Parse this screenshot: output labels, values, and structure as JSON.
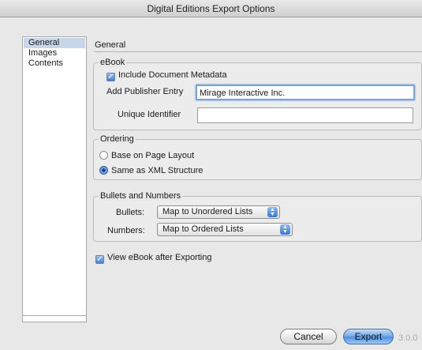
{
  "window": {
    "title": "Digital Editions Export Options"
  },
  "sidebar": {
    "items": [
      {
        "label": "General"
      },
      {
        "label": "Images"
      },
      {
        "label": "Contents"
      }
    ]
  },
  "main": {
    "heading": "General",
    "ebook": {
      "legend": "eBook",
      "include_metadata": {
        "label": "Include Document Metadata",
        "checked": true
      },
      "publisher": {
        "label": "Add Publisher Entry",
        "value": "Mirage Interactive Inc."
      },
      "identifier": {
        "label": "Unique Identifier",
        "value": ""
      }
    },
    "ordering": {
      "legend": "Ordering",
      "options": [
        {
          "label": "Base on Page Layout",
          "selected": false
        },
        {
          "label": "Same as XML Structure",
          "selected": true
        }
      ]
    },
    "bullets": {
      "legend": "Bullets and Numbers",
      "bullets_label": "Bullets:",
      "bullets_value": "Map to Unordered Lists",
      "numbers_label": "Numbers:",
      "numbers_value": "Map to Ordered Lists"
    },
    "view_after": {
      "label": "View eBook after Exporting",
      "checked": true
    }
  },
  "footer": {
    "cancel_label": "Cancel",
    "export_label": "Export",
    "version": "3.0.0"
  },
  "colors": {
    "accent": "#3e7fd6",
    "selection": "#c8d6ea"
  },
  "icons": {
    "checkbox": "checkmark-icon",
    "popup": "up-down-arrows-icon"
  }
}
